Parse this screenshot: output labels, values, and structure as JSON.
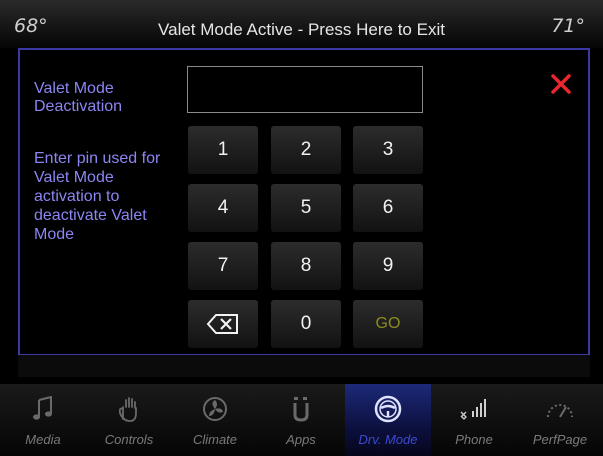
{
  "topbar": {
    "temp_left": "68°",
    "title": "Valet Mode Active - Press Here to Exit",
    "temp_right": "71°"
  },
  "panel": {
    "heading": "Valet Mode Deactivation",
    "description": "Enter pin used for Valet Mode activation to deactivate Valet Mode",
    "pin_value": "",
    "close_icon": "close-x-icon",
    "accent_color": "#e8262d"
  },
  "keypad": {
    "keys": [
      "1",
      "2",
      "3",
      "4",
      "5",
      "6",
      "7",
      "8",
      "9"
    ],
    "backspace_icon": "backspace-icon",
    "zero": "0",
    "go": "GO"
  },
  "nav": {
    "items": [
      {
        "label": "Media",
        "icon": "music-note-icon"
      },
      {
        "label": "Controls",
        "icon": "hand-icon"
      },
      {
        "label": "Climate",
        "icon": "fan-icon"
      },
      {
        "label": "Apps",
        "icon": "apps-icon"
      },
      {
        "label": "Drv. Mode",
        "icon": "steering-wheel-icon",
        "active": true
      },
      {
        "label": "Phone",
        "icon": "phone-signal-icon"
      },
      {
        "label": "PerfPage",
        "icon": "gauge-icon"
      }
    ]
  }
}
